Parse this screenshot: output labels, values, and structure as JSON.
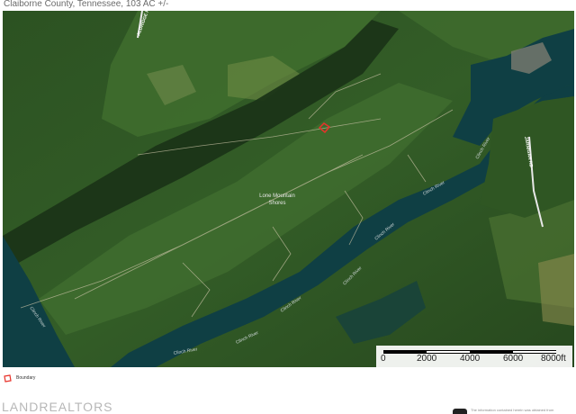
{
  "header": {
    "title": "Claiborne County, Tennessee, 103 AC +/-"
  },
  "map": {
    "labels": {
      "place": [
        "Lone Mountain",
        "Shores"
      ],
      "road_top": "ALDRIDGE RD",
      "road_right": "JARNIGAN RD",
      "river": "Clinch River"
    },
    "colors": {
      "forest_dark": "#1f3d1a",
      "forest": "#2f5a25",
      "water": "#0f3f44",
      "boundary": "#e8322a"
    }
  },
  "scale_bar": {
    "ticks": [
      "0",
      "2000",
      "4000",
      "6000",
      "8000ft"
    ]
  },
  "legend": {
    "label": "Boundary"
  },
  "footer": {
    "brand": "LANDREALTORS",
    "disclaimer": "The information contained herein was obtained from"
  }
}
